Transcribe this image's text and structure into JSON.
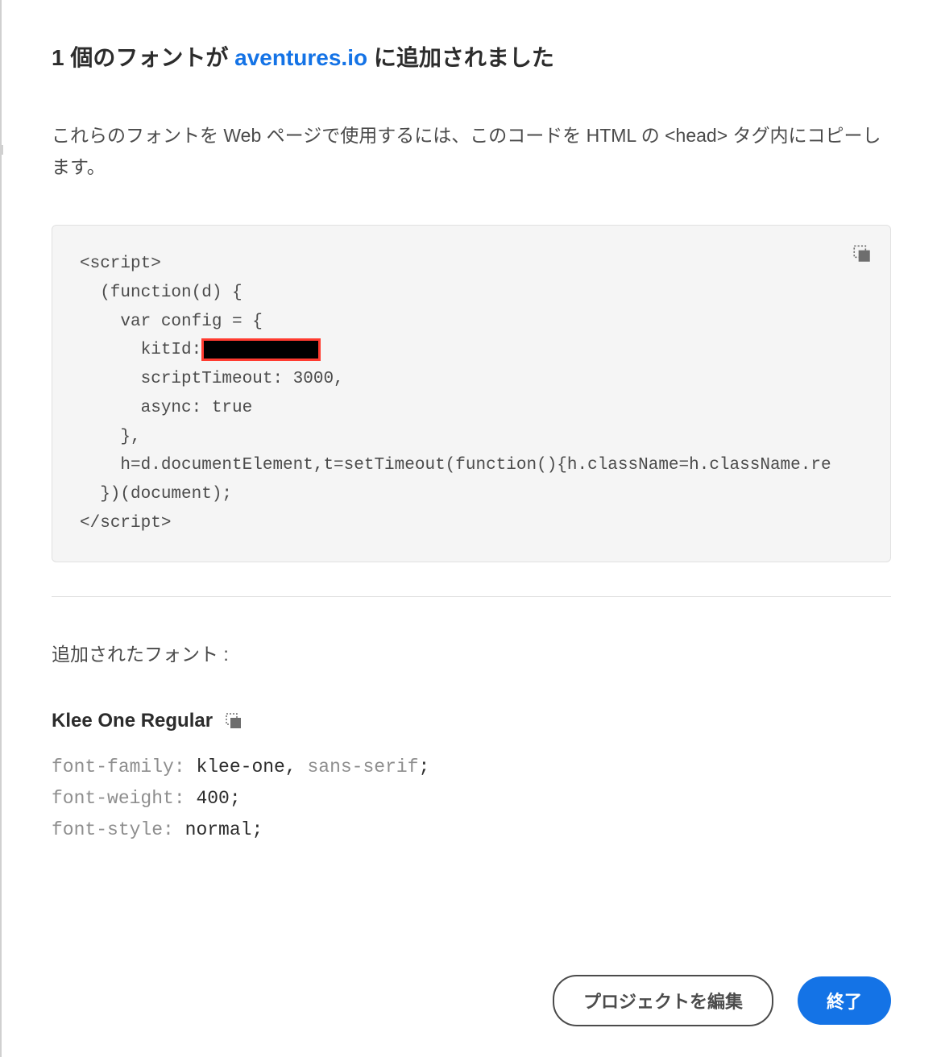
{
  "title": {
    "prefix": "1 個のフォントが ",
    "link": "aventures.io",
    "suffix": " に追加されました"
  },
  "description": "これらのフォントを Web ページで使用するには、このコードを HTML の <head> タグ内にコピーします。",
  "code": {
    "line1": "<script>",
    "line2": "  (function(d) {",
    "line3": "    var config = {",
    "line4_prefix": "      kitId:",
    "line5": "      scriptTimeout: 3000,",
    "line6": "      async: true",
    "line7": "    },",
    "line8": "    h=d.documentElement,t=setTimeout(function(){h.className=h.className.re",
    "line9": "  })(document);",
    "line10_part": "script>"
  },
  "added_fonts_label": "追加されたフォント :",
  "font": {
    "name": "Klee One Regular",
    "family_prop": "font-family: ",
    "family_val": "klee-one,",
    "family_fallback": " sans-serif",
    "family_semi": ";",
    "weight_prop": "font-weight: ",
    "weight_val": "400",
    "weight_semi": ";",
    "style_prop": "font-style: ",
    "style_val": "normal",
    "style_semi": ";"
  },
  "buttons": {
    "edit": "プロジェクトを編集",
    "done": "終了"
  }
}
